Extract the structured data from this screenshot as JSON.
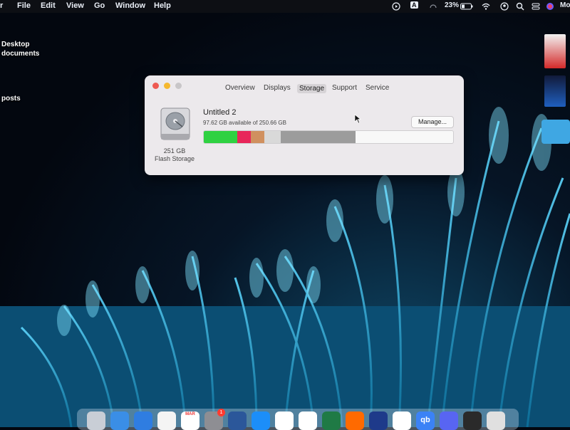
{
  "menubar": {
    "items": [
      "r",
      "File",
      "Edit",
      "View",
      "Go",
      "Window",
      "Help"
    ],
    "battery_percent": "23%",
    "input_source": "A",
    "user_short": "Mo"
  },
  "desktop": {
    "labels": [
      "Desktop",
      "documents",
      "posts"
    ]
  },
  "about_window": {
    "tabs": [
      "Overview",
      "Displays",
      "Storage",
      "Support",
      "Service"
    ],
    "active_tab": "Storage",
    "disk": {
      "capacity": "251 GB",
      "type": "Flash Storage"
    },
    "volume": {
      "name": "Untitled 2",
      "available_text": "97.62 GB available of 250.66 GB",
      "manage_label": "Manage...",
      "used_fraction": 0.61,
      "segments": [
        {
          "category": "apps",
          "color": "#2fd141",
          "fraction": 0.135
        },
        {
          "category": "documents",
          "color": "#e8265a",
          "fraction": 0.055
        },
        {
          "category": "media",
          "color": "#d0905f",
          "fraction": 0.055
        },
        {
          "category": "other",
          "color": "#d9d9d9",
          "fraction": 0.065
        },
        {
          "category": "system",
          "color": "#9c9c9c",
          "fraction": 0.3
        }
      ]
    }
  },
  "colors": {
    "window_bg": "#ece9ec",
    "menubar_bg": "#0d0f14",
    "close": "#ee5a52",
    "minimize": "#f5b82e",
    "zoom": "#c8c6c8"
  },
  "dock": {
    "apps": [
      "launchpad-icon",
      "safari-icon",
      "mail-icon",
      "photos-icon",
      "calendar-icon",
      "system-settings-icon",
      "word-icon",
      "app-store-icon",
      "slack-icon",
      "tasks-icon",
      "excel-icon",
      "video-icon",
      "notes-icon",
      "chrome-icon",
      "qb-icon",
      "discord-icon",
      "monitor-icon",
      "trash-icon"
    ],
    "calendar_month": "MAR",
    "qb_label": "qb",
    "badge_count": "1"
  }
}
